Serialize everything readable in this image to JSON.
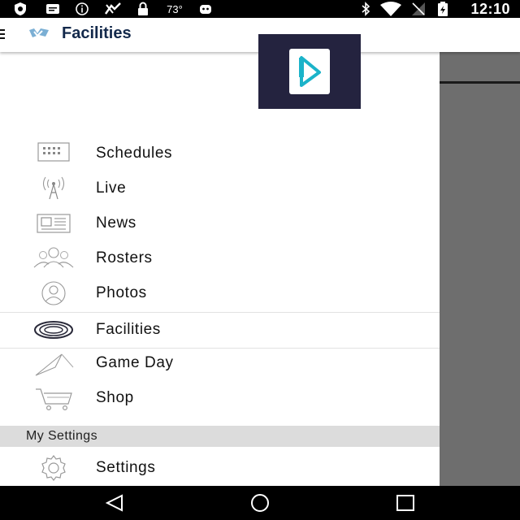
{
  "status_bar": {
    "time": "12:10",
    "temperature": "73°",
    "icons": [
      "shield-icon",
      "message-icon",
      "info-icon",
      "fantasy-icon",
      "lock-icon",
      "temperature-text",
      "android-icon",
      "bluetooth-icon",
      "wifi-icon",
      "no-signal-icon",
      "battery-icon"
    ]
  },
  "header": {
    "title": "Facilities",
    "logo": "unc-logo"
  },
  "promo_badge": {
    "icon": "play-logo-icon",
    "background": "#24233f",
    "accent": "#1bb3c9"
  },
  "menu": {
    "items": [
      {
        "label": "Schedules",
        "icon": "calendar-icon"
      },
      {
        "label": "Live",
        "icon": "broadcast-icon"
      },
      {
        "label": "News",
        "icon": "newspaper-icon"
      },
      {
        "label": "Rosters",
        "icon": "group-icon"
      },
      {
        "label": "Photos",
        "icon": "person-icon"
      },
      {
        "label": "Facilities",
        "icon": "stadium-icon",
        "active": true
      },
      {
        "label": "Game Day",
        "icon": "pennant-icon"
      },
      {
        "label": "Shop",
        "icon": "cart-icon"
      }
    ]
  },
  "settings_section": {
    "header": "My Settings",
    "items": [
      {
        "label": "Settings",
        "icon": "gear-icon"
      }
    ]
  },
  "nav_bar": {
    "buttons": [
      "back-icon",
      "home-icon",
      "recents-icon"
    ]
  },
  "colors": {
    "title": "#13294b",
    "overlay": "#6e6e6e",
    "section_header_bg": "#dcdcdc"
  }
}
